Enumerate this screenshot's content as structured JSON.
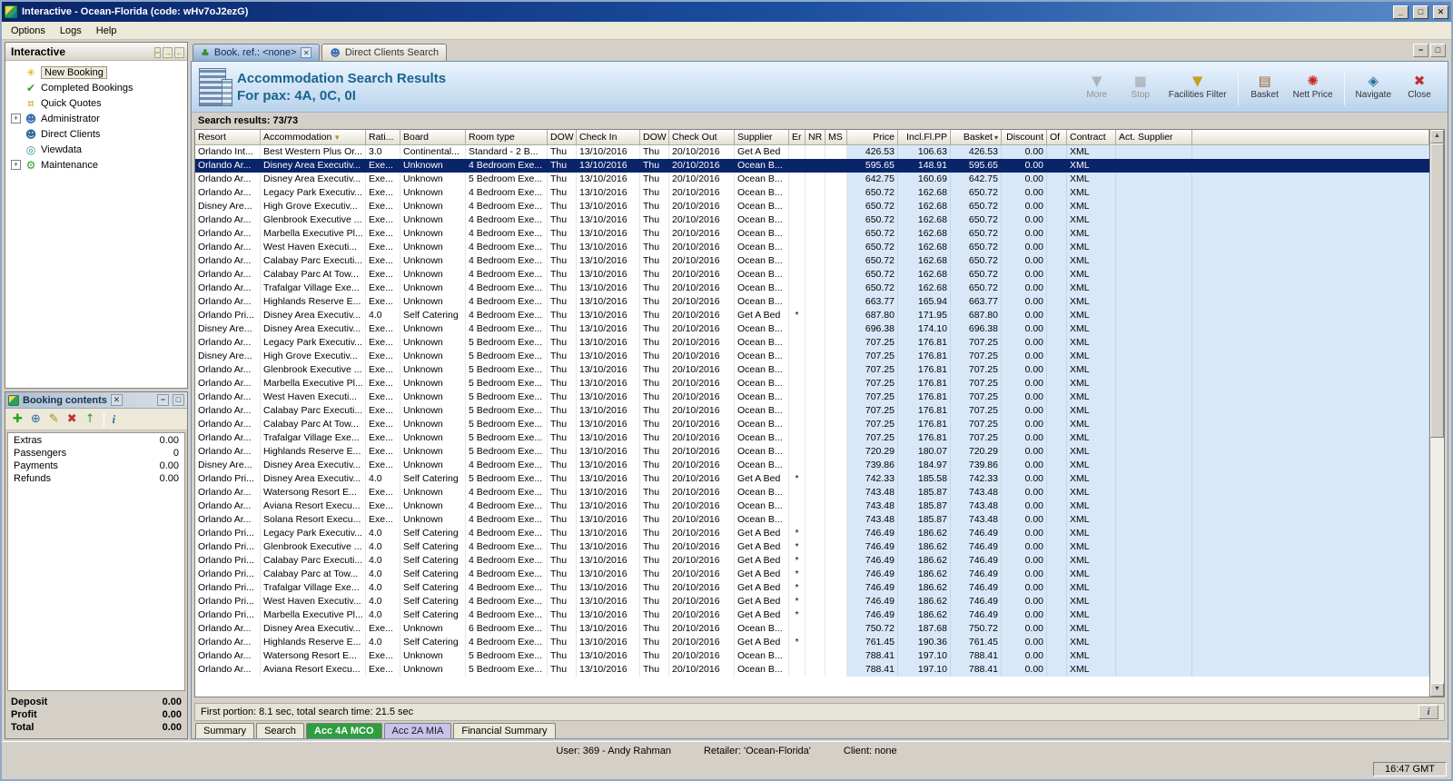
{
  "window": {
    "title": "Interactive - Ocean-Florida (code: wHv7oJ2ezG)",
    "controls": {
      "minimize": "_",
      "maximize": "□",
      "close": "✕"
    },
    "time": "16:47 GMT"
  },
  "menu": {
    "items": [
      "Options",
      "Logs",
      "Help"
    ]
  },
  "sidebar": {
    "title": "Interactive",
    "controls": [
      {
        "name": "collapse-panel-button",
        "glyph": "−"
      },
      {
        "name": "dock-right-button",
        "glyph": "→"
      },
      {
        "name": "dock-left-button",
        "glyph": "←"
      }
    ],
    "items": [
      {
        "label": "New Booking",
        "icon": "starburst-icon",
        "glyph": "✳",
        "color": "#e8a000",
        "selected": true
      },
      {
        "label": "Completed Bookings",
        "icon": "checklist-icon",
        "glyph": "✔",
        "color": "#2e9e2e"
      },
      {
        "label": "Quick Quotes",
        "icon": "coins-icon",
        "glyph": "¤",
        "color": "#c8a020"
      },
      {
        "label": "Administrator",
        "icon": "administrator-icon",
        "glyph": "☻",
        "color": "#3c6eb4",
        "expandable": true
      },
      {
        "label": "Direct Clients",
        "icon": "person-icon",
        "glyph": "☻",
        "color": "#2e6da0"
      },
      {
        "label": "Viewdata",
        "icon": "globe-icon",
        "glyph": "◎",
        "color": "#2e8b8b"
      },
      {
        "label": "Maintenance",
        "icon": "gear-icon",
        "glyph": "⚙",
        "color": "#2e9e2e",
        "expandable": true
      }
    ]
  },
  "booking_contents": {
    "title": "Booking contents",
    "controls": {
      "close": "✕",
      "minimize": "−",
      "maximize": "□"
    },
    "toolbar": [
      {
        "name": "add-icon",
        "glyph": "✚",
        "color": "#2aa02a"
      },
      {
        "name": "globe-icon",
        "glyph": "⊕",
        "color": "#2e6da0"
      },
      {
        "name": "edit-icon",
        "glyph": "✎",
        "color": "#b08020"
      },
      {
        "name": "delete-icon",
        "glyph": "✖",
        "color": "#c03030"
      },
      {
        "name": "upgrade-icon",
        "glyph": "↑",
        "color": "#2aa02a"
      },
      {
        "name": "info-icon",
        "glyph": "i",
        "color": "#2e6da0",
        "sep_before": true
      }
    ],
    "rows": [
      {
        "label": "Extras",
        "value": "0.00"
      },
      {
        "label": "Passengers",
        "value": "0"
      },
      {
        "label": "Payments",
        "value": "0.00"
      },
      {
        "label": "Refunds",
        "value": "0.00"
      }
    ],
    "totals": [
      {
        "label": "Deposit",
        "value": "0.00"
      },
      {
        "label": "Profit",
        "value": "0.00"
      },
      {
        "label": "Total",
        "value": "0.00"
      }
    ]
  },
  "tabs": [
    {
      "label": "Book. ref.: <none>",
      "icon": "palm-icon",
      "glyph": "♣",
      "color": "#2e8b2e",
      "active": true,
      "closable": true
    },
    {
      "label": "Direct Clients Search",
      "icon": "person-icon",
      "glyph": "☻",
      "color": "#3c6eb4"
    }
  ],
  "main": {
    "panel_controls": {
      "minimize": "−",
      "maximize": "□"
    },
    "title": "Accommodation Search Results",
    "subtitle": "For pax: 4A, 0C, 0I",
    "toolbar": [
      {
        "label": "More",
        "name": "more-button",
        "icon": "more-icon",
        "glyph": "▼",
        "color": "#8a8a8a",
        "enabled": false
      },
      {
        "label": "Stop",
        "name": "stop-button",
        "icon": "stop-icon",
        "glyph": "■",
        "color": "#9a9a9a",
        "enabled": false
      },
      {
        "label": "Facilities Filter",
        "name": "facilities-filter-button",
        "icon": "filter-icon",
        "glyph": "▼",
        "color": "#c8a020",
        "enabled": true
      },
      {
        "label": "Basket",
        "name": "basket-button",
        "icon": "basket-icon",
        "glyph": "▤",
        "color": "#a0622a",
        "enabled": true,
        "sep_before": true
      },
      {
        "label": "Nett Price",
        "name": "nett-price-button",
        "icon": "rosette-icon",
        "glyph": "✺",
        "color": "#cc2020",
        "enabled": true
      },
      {
        "label": "Navigate",
        "name": "navigate-button",
        "icon": "compass-icon",
        "glyph": "◈",
        "color": "#2e6da0",
        "enabled": true,
        "sep_before": true
      },
      {
        "label": "Close",
        "name": "close-button",
        "icon": "close-icon",
        "glyph": "✖",
        "color": "#c03030",
        "enabled": true
      }
    ],
    "results_label": "Search results: 73/73",
    "table": {
      "columns": [
        {
          "label": "Resort"
        },
        {
          "label": "Accommodation",
          "icon": "filter-icon",
          "icon_glyph": "▼",
          "icon_color": "#b89020"
        },
        {
          "label": "Rati..."
        },
        {
          "label": "Board"
        },
        {
          "label": "Room type"
        },
        {
          "label": "DOW"
        },
        {
          "label": "Check In"
        },
        {
          "label": "DOW"
        },
        {
          "label": "Check Out"
        },
        {
          "label": "Supplier"
        },
        {
          "label": "Er"
        },
        {
          "label": "NR"
        },
        {
          "label": "MS"
        },
        {
          "label": "Price"
        },
        {
          "label": "Incl.Fl.PP"
        },
        {
          "label": "Basket",
          "icon": "sort-icon",
          "icon_glyph": "▾",
          "icon_color": "#404040"
        },
        {
          "label": "Discount"
        },
        {
          "label": "Of"
        },
        {
          "label": "Contract"
        },
        {
          "label": "Act. Supplier"
        }
      ],
      "row_defaults": {
        "dow_in": "Thu",
        "check_in": "13/10/2016",
        "dow_out": "Thu",
        "check_out": "20/10/2016",
        "discount": "0.00",
        "contract": "XML"
      },
      "selected_index": 1,
      "rows": [
        [
          "Orlando Int...",
          "Best Western Plus Or...",
          "3.0",
          "Continental...",
          "Standard - 2 B...",
          "Get A Bed",
          "",
          "426.53",
          "106.63"
        ],
        [
          "Orlando Ar...",
          "Disney Area Executiv...",
          "Exe...",
          "Unknown",
          "4 Bedroom Exe...",
          "Ocean B...",
          "",
          "595.65",
          "148.91"
        ],
        [
          "Orlando Ar...",
          "Disney Area Executiv...",
          "Exe...",
          "Unknown",
          "5 Bedroom Exe...",
          "Ocean B...",
          "",
          "642.75",
          "160.69"
        ],
        [
          "Orlando Ar...",
          "Legacy Park Executiv...",
          "Exe...",
          "Unknown",
          "4 Bedroom Exe...",
          "Ocean B...",
          "",
          "650.72",
          "162.68"
        ],
        [
          "Disney Are...",
          "High Grove Executiv...",
          "Exe...",
          "Unknown",
          "4 Bedroom Exe...",
          "Ocean B...",
          "",
          "650.72",
          "162.68"
        ],
        [
          "Orlando Ar...",
          "Glenbrook Executive ...",
          "Exe...",
          "Unknown",
          "4 Bedroom Exe...",
          "Ocean B...",
          "",
          "650.72",
          "162.68"
        ],
        [
          "Orlando Ar...",
          "Marbella Executive Pl...",
          "Exe...",
          "Unknown",
          "4 Bedroom Exe...",
          "Ocean B...",
          "",
          "650.72",
          "162.68"
        ],
        [
          "Orlando Ar...",
          "West Haven Executi...",
          "Exe...",
          "Unknown",
          "4 Bedroom Exe...",
          "Ocean B...",
          "",
          "650.72",
          "162.68"
        ],
        [
          "Orlando Ar...",
          "Calabay Parc Executi...",
          "Exe...",
          "Unknown",
          "4 Bedroom Exe...",
          "Ocean B...",
          "",
          "650.72",
          "162.68"
        ],
        [
          "Orlando Ar...",
          "Calabay Parc At Tow...",
          "Exe...",
          "Unknown",
          "4 Bedroom Exe...",
          "Ocean B...",
          "",
          "650.72",
          "162.68"
        ],
        [
          "Orlando Ar...",
          "Trafalgar Village Exe...",
          "Exe...",
          "Unknown",
          "4 Bedroom Exe...",
          "Ocean B...",
          "",
          "650.72",
          "162.68"
        ],
        [
          "Orlando Ar...",
          "Highlands Reserve E...",
          "Exe...",
          "Unknown",
          "4 Bedroom Exe...",
          "Ocean B...",
          "",
          "663.77",
          "165.94"
        ],
        [
          "Orlando Pri...",
          "Disney Area Executiv...",
          "4.0",
          "Self Catering",
          "4 Bedroom Exe...",
          "Get A Bed",
          "*",
          "687.80",
          "171.95"
        ],
        [
          "Disney Are...",
          "Disney Area Executiv...",
          "Exe...",
          "Unknown",
          "4 Bedroom Exe...",
          "Ocean B...",
          "",
          "696.38",
          "174.10"
        ],
        [
          "Orlando Ar...",
          "Legacy Park Executiv...",
          "Exe...",
          "Unknown",
          "5 Bedroom Exe...",
          "Ocean B...",
          "",
          "707.25",
          "176.81"
        ],
        [
          "Disney Are...",
          "High Grove Executiv...",
          "Exe...",
          "Unknown",
          "5 Bedroom Exe...",
          "Ocean B...",
          "",
          "707.25",
          "176.81"
        ],
        [
          "Orlando Ar...",
          "Glenbrook Executive ...",
          "Exe...",
          "Unknown",
          "5 Bedroom Exe...",
          "Ocean B...",
          "",
          "707.25",
          "176.81"
        ],
        [
          "Orlando Ar...",
          "Marbella Executive Pl...",
          "Exe...",
          "Unknown",
          "5 Bedroom Exe...",
          "Ocean B...",
          "",
          "707.25",
          "176.81"
        ],
        [
          "Orlando Ar...",
          "West Haven Executi...",
          "Exe...",
          "Unknown",
          "5 Bedroom Exe...",
          "Ocean B...",
          "",
          "707.25",
          "176.81"
        ],
        [
          "Orlando Ar...",
          "Calabay Parc Executi...",
          "Exe...",
          "Unknown",
          "5 Bedroom Exe...",
          "Ocean B...",
          "",
          "707.25",
          "176.81"
        ],
        [
          "Orlando Ar...",
          "Calabay Parc At Tow...",
          "Exe...",
          "Unknown",
          "5 Bedroom Exe...",
          "Ocean B...",
          "",
          "707.25",
          "176.81"
        ],
        [
          "Orlando Ar...",
          "Trafalgar Village Exe...",
          "Exe...",
          "Unknown",
          "5 Bedroom Exe...",
          "Ocean B...",
          "",
          "707.25",
          "176.81"
        ],
        [
          "Orlando Ar...",
          "Highlands Reserve E...",
          "Exe...",
          "Unknown",
          "5 Bedroom Exe...",
          "Ocean B...",
          "",
          "720.29",
          "180.07"
        ],
        [
          "Disney Are...",
          "Disney Area Executiv...",
          "Exe...",
          "Unknown",
          "4 Bedroom Exe...",
          "Ocean B...",
          "",
          "739.86",
          "184.97"
        ],
        [
          "Orlando Pri...",
          "Disney Area Executiv...",
          "4.0",
          "Self Catering",
          "5 Bedroom Exe...",
          "Get A Bed",
          "*",
          "742.33",
          "185.58"
        ],
        [
          "Orlando Ar...",
          "Watersong Resort E...",
          "Exe...",
          "Unknown",
          "4 Bedroom Exe...",
          "Ocean B...",
          "",
          "743.48",
          "185.87"
        ],
        [
          "Orlando Ar...",
          "Aviana Resort Execu...",
          "Exe...",
          "Unknown",
          "4 Bedroom Exe...",
          "Ocean B...",
          "",
          "743.48",
          "185.87"
        ],
        [
          "Orlando Ar...",
          "Solana Resort Execu...",
          "Exe...",
          "Unknown",
          "4 Bedroom Exe...",
          "Ocean B...",
          "",
          "743.48",
          "185.87"
        ],
        [
          "Orlando Pri...",
          "Legacy Park Executiv...",
          "4.0",
          "Self Catering",
          "4 Bedroom Exe...",
          "Get A Bed",
          "*",
          "746.49",
          "186.62"
        ],
        [
          "Orlando Pri...",
          "Glenbrook Executive ...",
          "4.0",
          "Self Catering",
          "4 Bedroom Exe...",
          "Get A Bed",
          "*",
          "746.49",
          "186.62"
        ],
        [
          "Orlando Pri...",
          "Calabay Parc Executi...",
          "4.0",
          "Self Catering",
          "4 Bedroom Exe...",
          "Get A Bed",
          "*",
          "746.49",
          "186.62"
        ],
        [
          "Orlando Pri...",
          "Calabay Parc at Tow...",
          "4.0",
          "Self Catering",
          "4 Bedroom Exe...",
          "Get A Bed",
          "*",
          "746.49",
          "186.62"
        ],
        [
          "Orlando Pri...",
          "Trafalgar Village Exe...",
          "4.0",
          "Self Catering",
          "4 Bedroom Exe...",
          "Get A Bed",
          "*",
          "746.49",
          "186.62"
        ],
        [
          "Orlando Pri...",
          "West Haven Executiv...",
          "4.0",
          "Self Catering",
          "4 Bedroom Exe...",
          "Get A Bed",
          "*",
          "746.49",
          "186.62"
        ],
        [
          "Orlando Pri...",
          "Marbella Executive Pl...",
          "4.0",
          "Self Catering",
          "4 Bedroom Exe...",
          "Get A Bed",
          "*",
          "746.49",
          "186.62"
        ],
        [
          "Orlando Ar...",
          "Disney Area Executiv...",
          "Exe...",
          "Unknown",
          "6 Bedroom Exe...",
          "Ocean B...",
          "",
          "750.72",
          "187.68"
        ],
        [
          "Orlando Ar...",
          "Highlands Reserve E...",
          "4.0",
          "Self Catering",
          "4 Bedroom Exe...",
          "Get A Bed",
          "*",
          "761.45",
          "190.36"
        ],
        [
          "Orlando Ar...",
          "Watersong Resort E...",
          "Exe...",
          "Unknown",
          "5 Bedroom Exe...",
          "Ocean B...",
          "",
          "788.41",
          "197.10"
        ],
        [
          "Orlando Ar...",
          "Aviana Resort Execu...",
          "Exe...",
          "Unknown",
          "5 Bedroom Exe...",
          "Ocean B...",
          "",
          "788.41",
          "197.10"
        ]
      ]
    },
    "scrollbar": {
      "up": "▲",
      "down": "▼"
    },
    "footer": "First portion: 8.1 sec, total search time: 21.5 sec",
    "info_button": "i",
    "bottom_tabs": [
      {
        "label": "Summary"
      },
      {
        "label": "Search"
      },
      {
        "label": "Acc 4A MCO",
        "bg": "#2f9e3f",
        "fg": "#ffffff",
        "active": true
      },
      {
        "label": "Acc 2A MIA",
        "bg": "#c9c2ea",
        "fg": "#1a1a1a"
      },
      {
        "label": "Financial Summary"
      }
    ]
  },
  "statusbar": {
    "user": "User: 369 - Andy Rahman",
    "retailer": "Retailer: 'Ocean-Florida'",
    "client": "Client: none"
  }
}
